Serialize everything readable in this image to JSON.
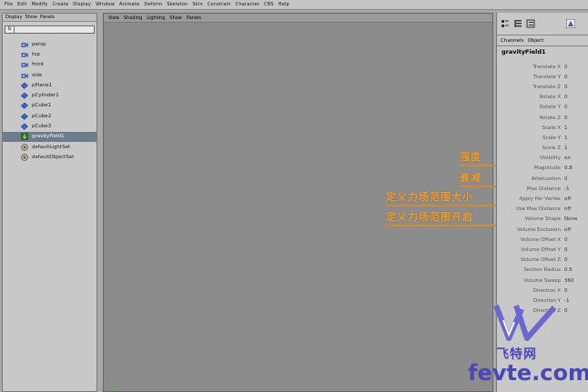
{
  "menubar": {
    "items": [
      "File",
      "Edit",
      "Modify",
      "Create",
      "Display",
      "Window",
      "Animate",
      "Deform",
      "Skeleton",
      "Skin",
      "Constrain",
      "Character",
      "CBS",
      "Help"
    ]
  },
  "outliner": {
    "menu": [
      "Display",
      "Show",
      "Panels"
    ],
    "filter_value": "",
    "items": [
      {
        "label": "persp",
        "icon": "camera-icon",
        "selected": false
      },
      {
        "label": "top",
        "icon": "camera-icon",
        "selected": false
      },
      {
        "label": "front",
        "icon": "camera-icon",
        "selected": false
      },
      {
        "label": "side",
        "icon": "camera-icon",
        "selected": false
      },
      {
        "label": "pPlane1",
        "icon": "mesh-icon",
        "selected": false
      },
      {
        "label": "pCylinder1",
        "icon": "mesh-icon",
        "selected": false
      },
      {
        "label": "pCube1",
        "icon": "mesh-icon",
        "selected": false
      },
      {
        "label": "pCube2",
        "icon": "mesh-icon",
        "selected": false
      },
      {
        "label": "pCube3",
        "icon": "mesh-icon",
        "selected": false
      },
      {
        "label": "gravityField1",
        "icon": "field-icon",
        "selected": true
      },
      {
        "label": "defaultLightSet",
        "icon": "set-icon",
        "selected": false
      },
      {
        "label": "defaultObjectSet",
        "icon": "set-icon",
        "selected": false
      }
    ]
  },
  "viewport": {
    "menu": [
      "View",
      "Shading",
      "Lighting",
      "Show",
      "Panels"
    ]
  },
  "channelbox": {
    "tabs": [
      "Channels",
      "Object"
    ],
    "node": "gravityField1",
    "attributes": [
      {
        "name": "Translate X",
        "value": "0"
      },
      {
        "name": "Translate Y",
        "value": "0"
      },
      {
        "name": "Translate Z",
        "value": "0"
      },
      {
        "name": "Rotate X",
        "value": "0"
      },
      {
        "name": "Rotate Y",
        "value": "0"
      },
      {
        "name": "Rotate Z",
        "value": "0"
      },
      {
        "name": "Scale X",
        "value": "1"
      },
      {
        "name": "Scale Y",
        "value": "1"
      },
      {
        "name": "Scale Z",
        "value": "1"
      },
      {
        "name": "Visibility",
        "value": "on"
      },
      {
        "name": "Magnitude",
        "value": "9.8"
      },
      {
        "name": "Attenuation",
        "value": "0"
      },
      {
        "name": "Max Distance",
        "value": "-1"
      },
      {
        "name": "Apply Per Vertex",
        "value": "off"
      },
      {
        "name": "Use Max Distance",
        "value": "off"
      },
      {
        "name": "Volume Shape",
        "value": "None"
      },
      {
        "name": "Volume Exclusion",
        "value": "off"
      },
      {
        "name": "Volume Offset X",
        "value": "0"
      },
      {
        "name": "Volume Offset Y",
        "value": "0"
      },
      {
        "name": "Volume Offset Z",
        "value": "0"
      },
      {
        "name": "Section Radius",
        "value": "0.5"
      },
      {
        "name": "Volume Sweep",
        "value": "360"
      },
      {
        "name": "Direction X",
        "value": "0"
      },
      {
        "name": "Direction Y",
        "value": "-1"
      },
      {
        "name": "Direction Z",
        "value": "0"
      }
    ]
  },
  "annotations": [
    "强度",
    "衰减",
    "定义力场范围大小",
    "定义力场范围开启"
  ],
  "watermark": {
    "cn": "飞特网",
    "en": "fevte.com"
  },
  "colors": {
    "annotation": "#e8a040",
    "watermark": "#4a47b8",
    "selection": "#6c7c8c"
  }
}
